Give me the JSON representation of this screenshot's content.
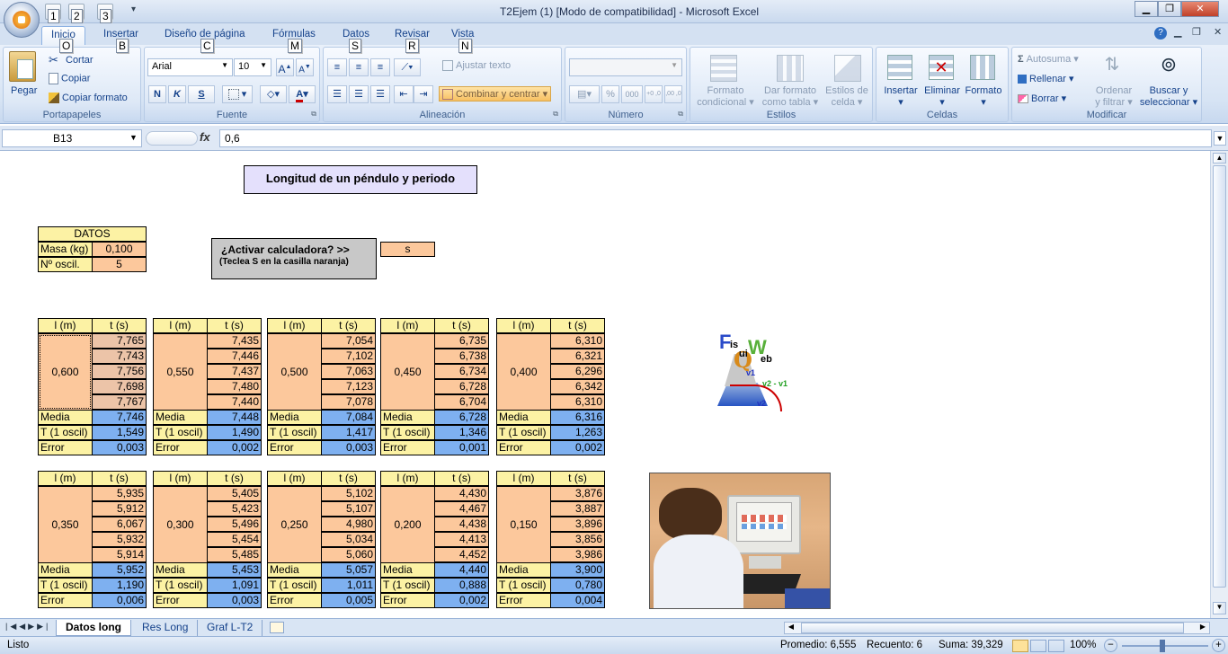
{
  "window": {
    "title": "T2Ejem (1)  [Modo de compatibilidad] - Microsoft Excel"
  },
  "quick_access": [
    "1",
    "2",
    "3"
  ],
  "ribbon_tabs": [
    {
      "label": "Inicio",
      "key": "O"
    },
    {
      "label": "Insertar",
      "key": "B"
    },
    {
      "label": "Diseño de página",
      "key": "C"
    },
    {
      "label": "Fórmulas",
      "key": "M"
    },
    {
      "label": "Datos",
      "key": "S"
    },
    {
      "label": "Revisar",
      "key": "R"
    },
    {
      "label": "Vista",
      "key": "N"
    }
  ],
  "ribbon": {
    "portapapeles": {
      "label": "Portapapeles",
      "pegar": "Pegar",
      "cortar": "Cortar",
      "copiar": "Copiar",
      "copiar_formato": "Copiar formato"
    },
    "fuente": {
      "label": "Fuente",
      "font": "Arial",
      "size": "10",
      "bold": "N",
      "italic": "K",
      "underline": "S"
    },
    "alineacion": {
      "label": "Alineación",
      "ajustar": "Ajustar texto",
      "combinar": "Combinar y centrar"
    },
    "numero": {
      "label": "Número",
      "percent": "%",
      "thousands": "000",
      "inc": "+0 ,0",
      "dec": ",00 ,0"
    },
    "estilos": {
      "label": "Estilos",
      "formato_condicional": [
        "Formato",
        "condicional"
      ],
      "dar_formato": [
        "Dar formato",
        "como tabla"
      ],
      "estilos_celda": [
        "Estilos de",
        "celda"
      ]
    },
    "celdas": {
      "label": "Celdas",
      "insertar": "Insertar",
      "eliminar": "Eliminar",
      "formato": "Formato"
    },
    "modificar": {
      "label": "Modificar",
      "autosuma": "Autosuma",
      "rellenar": "Rellenar",
      "borrar": "Borrar",
      "ordenar": [
        "Ordenar",
        "y filtrar"
      ],
      "buscar": [
        "Buscar y",
        "seleccionar"
      ]
    }
  },
  "formula_bar": {
    "name_box": "B13",
    "fx": "fx",
    "formula": "0,6"
  },
  "sheet": {
    "title": "Longitud de un péndulo y periodo",
    "datos": {
      "header": "DATOS",
      "masa_label": "Masa (kg)",
      "masa_value": "0,100",
      "osc_label": "Nº oscil.",
      "osc_value": "5"
    },
    "calc": {
      "question": "¿Activar  calculadora? >>",
      "hint": "(Teclea S en la casilla naranja)",
      "answer": "s"
    },
    "col_l": "l (m)",
    "col_t": "t (s)",
    "media_label": "Media",
    "t_label": "T (1 oscil)",
    "error_label": "Error",
    "blocks": [
      {
        "l": "0,600",
        "t": [
          "7,765",
          "7,743",
          "7,756",
          "7,698",
          "7,767"
        ],
        "media": "7,746",
        "T": "1,549",
        "error": "0,003"
      },
      {
        "l": "0,550",
        "t": [
          "7,435",
          "7,446",
          "7,437",
          "7,480",
          "7,440"
        ],
        "media": "7,448",
        "T": "1,490",
        "error": "0,002"
      },
      {
        "l": "0,500",
        "t": [
          "7,054",
          "7,102",
          "7,063",
          "7,123",
          "7,078"
        ],
        "media": "7,084",
        "T": "1,417",
        "error": "0,003"
      },
      {
        "l": "0,450",
        "t": [
          "6,735",
          "6,738",
          "6,734",
          "6,728",
          "6,704"
        ],
        "media": "6,728",
        "T": "1,346",
        "error": "0,001"
      },
      {
        "l": "0,400",
        "t": [
          "6,310",
          "6,321",
          "6,296",
          "6,342",
          "6,310"
        ],
        "media": "6,316",
        "T": "1,263",
        "error": "0,002"
      },
      {
        "l": "0,350",
        "t": [
          "5,935",
          "5,912",
          "6,067",
          "5,932",
          "5,914"
        ],
        "media": "5,952",
        "T": "1,190",
        "error": "0,006"
      },
      {
        "l": "0,300",
        "t": [
          "5,405",
          "5,423",
          "5,496",
          "5,454",
          "5,485"
        ],
        "media": "5,453",
        "T": "1,091",
        "error": "0,003"
      },
      {
        "l": "0,250",
        "t": [
          "5,102",
          "5,107",
          "4,980",
          "5,034",
          "5,060"
        ],
        "media": "5,057",
        "T": "1,011",
        "error": "0,005"
      },
      {
        "l": "0,200",
        "t": [
          "4,430",
          "4,467",
          "4,438",
          "4,413",
          "4,452"
        ],
        "media": "4,440",
        "T": "0,888",
        "error": "0,002"
      },
      {
        "l": "0,150",
        "t": [
          "3,876",
          "3,887",
          "3,896",
          "3,856",
          "3,986"
        ],
        "media": "3,900",
        "T": "0,780",
        "error": "0,004"
      }
    ],
    "logo": {
      "f": "F",
      "is": "is",
      "qui": "ui",
      "web": "eb",
      "v1": "v1",
      "v2v1": "v2 - v1",
      "v2": "v2"
    }
  },
  "sheet_tabs": [
    "Datos long",
    "Res Long",
    "Graf L-T2"
  ],
  "status": {
    "ready": "Listo",
    "promedio": "Promedio: 6,555",
    "recuento": "Recuento: 6",
    "suma": "Suma: 39,329",
    "zoom": "100%"
  },
  "colors": {
    "orange": "#fcc89c",
    "yellow": "#fcf2a4",
    "blue": "#7eb0f0",
    "title_box": "#e4e0fc"
  }
}
